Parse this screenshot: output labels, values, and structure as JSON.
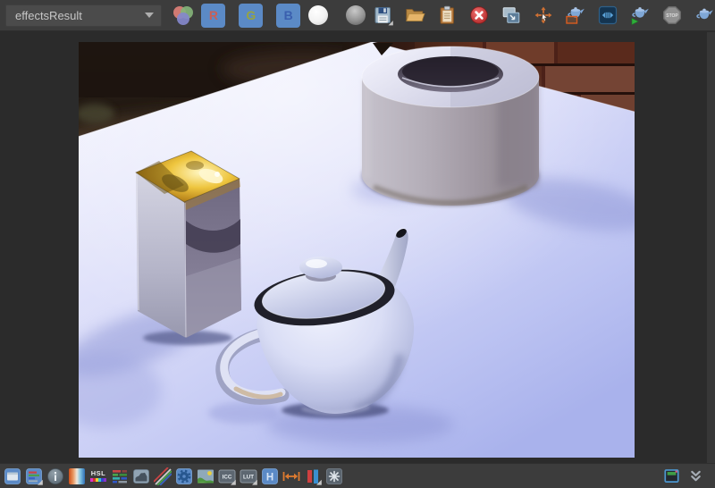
{
  "colors": {
    "toolbar-bg": "#3c3c3c",
    "viewport-bg": "#2b2b2b",
    "dropdown-bg": "#4b4b4b",
    "button-blue": "#5b8ac6"
  },
  "toolbar": {
    "channel_dropdown": {
      "value": "effectsResult"
    },
    "channel_buttons": [
      {
        "label": "R"
      },
      {
        "label": "G"
      },
      {
        "label": "B"
      }
    ],
    "stop_label": "STOP",
    "icons": [
      "rgb-channels",
      "white-point",
      "gray-point",
      "save",
      "open-folder",
      "clipboard",
      "delete",
      "snapshot-copy",
      "pan-move",
      "render-region",
      "ipr-toggle",
      "render-start",
      "render-stop",
      "render-scene"
    ]
  },
  "statusbar": {
    "labels": {
      "hsl": "HSL",
      "icc": "ICC",
      "lut": "LUT",
      "h": "H"
    },
    "icons": [
      "display-panel",
      "channel-bars",
      "info",
      "false-color",
      "hsl",
      "channel-rows",
      "histogram",
      "curves",
      "processing-gear",
      "image-display",
      "icc-profile",
      "lut",
      "h-matte",
      "fit-width",
      "ab-compare",
      "sparkle",
      "mini-window",
      "collapse"
    ]
  },
  "render_view": {
    "scene_objects": [
      "brick wall background",
      "white table",
      "mirror box with gold reflection",
      "hollow cylinder",
      "utah teapot"
    ],
    "palette": {
      "table": "#c9cdf2",
      "shadow": "#8d95d5",
      "gold": "#eec53e",
      "brick": "#63301f"
    }
  }
}
